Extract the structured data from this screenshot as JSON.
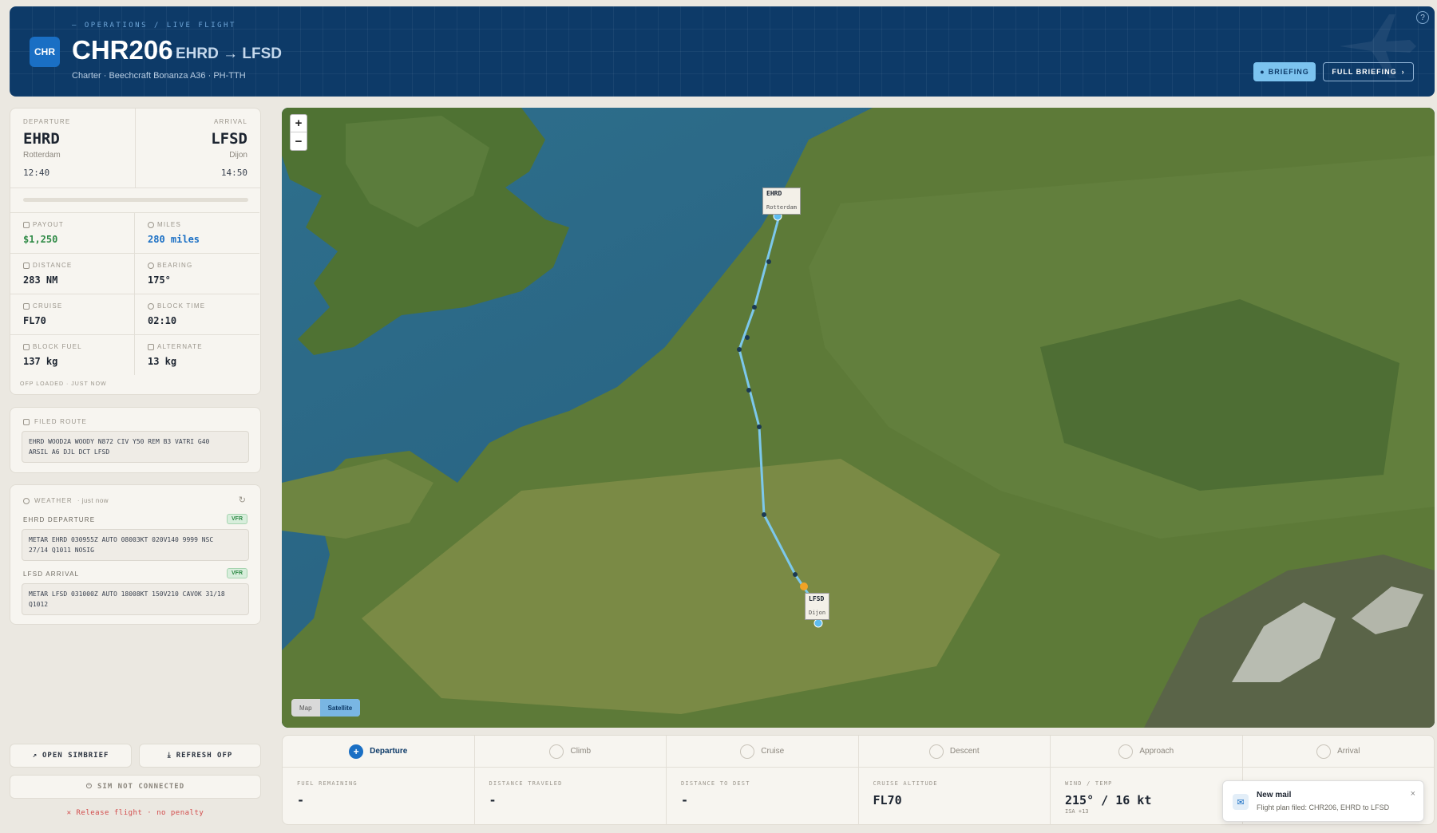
{
  "header": {
    "breadcrumb": "— OPERATIONS / LIVE FLIGHT",
    "logo": "CHR",
    "flight_number": "CHR206",
    "route": "EHRD → LFSD",
    "subtitle": "Charter · Beechcraft Bonanza A36 · PH-TTH",
    "briefing_label": "BRIEFING",
    "full_briefing_label": "FULL BRIEFING",
    "help_icon": "?"
  },
  "departure": {
    "label": "DEPARTURE",
    "icao": "EHRD",
    "city": "Rotterdam",
    "time": "12:40"
  },
  "arrival": {
    "label": "ARRIVAL",
    "icao": "LFSD",
    "city": "Dijon",
    "time": "14:50"
  },
  "progress_percent": 0,
  "stats": {
    "payout": {
      "label": "PAYOUT",
      "value": "$1,250"
    },
    "miles": {
      "label": "MILES",
      "value": "280 miles"
    },
    "distance": {
      "label": "DISTANCE",
      "value": "283 NM"
    },
    "bearing": {
      "label": "BEARING",
      "value": "175°"
    },
    "cruise": {
      "label": "CRUISE",
      "value": "FL70"
    },
    "block_time": {
      "label": "BLOCK TIME",
      "value": "02:10"
    },
    "block_fuel": {
      "label": "BLOCK FUEL",
      "value": "137 kg"
    },
    "alternate": {
      "label": "ALTERNATE",
      "value": "13 kg"
    }
  },
  "ofp_status": "OFP LOADED · JUST NOW",
  "filed_route": {
    "label": "FILED ROUTE",
    "line1": "EHRD WOOD2A WOODY N872 CIV Y50 REM B3 VATRI G40",
    "line2": "ARSIL A6 DJL DCT LFSD"
  },
  "weather": {
    "label": "WEATHER",
    "updated": "· just now",
    "departure_label": "EHRD DEPARTURE",
    "departure_cat": "VFR",
    "departure_metar_1": "METAR EHRD 030955Z AUTO 08003KT 020V140 9999 NSC",
    "departure_metar_2": "27/14 Q1011 NOSIG",
    "arrival_label": "LFSD ARRIVAL",
    "arrival_cat": "VFR",
    "arrival_metar_1": "METAR LFSD 031000Z AUTO 18008KT 150V210 CAVOK 31/18",
    "arrival_metar_2": "Q1012"
  },
  "actions": {
    "open_simbrief": "OPEN SIMBRIEF",
    "refresh_ofp": "REFRESH OFP",
    "sim_status": "SIM NOT CONNECTED",
    "release": "✕  Release flight · no penalty"
  },
  "map": {
    "zoom_in": "+",
    "zoom_out": "−",
    "toggle_map": "Map",
    "toggle_satellite": "Satellite",
    "dep_label": "EHRD",
    "dep_city": "Rotterdam",
    "arr_label": "LFSD",
    "arr_city": "Dijon",
    "route_color": "#7cc8ec"
  },
  "phases": [
    {
      "label": "Departure",
      "active": true
    },
    {
      "label": "Climb"
    },
    {
      "label": "Cruise"
    },
    {
      "label": "Descent"
    },
    {
      "label": "Approach"
    },
    {
      "label": "Arrival"
    }
  ],
  "live": {
    "fuel_remaining": {
      "label": "FUEL REMAINING",
      "value": "-"
    },
    "distance_traveled": {
      "label": "DISTANCE TRAVELED",
      "value": "-"
    },
    "distance_to_dest": {
      "label": "DISTANCE TO DEST",
      "value": "-"
    },
    "cruise_altitude": {
      "label": "CRUISE ALTITUDE",
      "value": "FL70"
    },
    "wind_temp": {
      "label": "WIND / TEMP",
      "value": "215° / 16 kt",
      "isa": "ISA +13"
    }
  },
  "toast": {
    "title": "New mail",
    "body": "Flight plan filed: CHR206, EHRD to LFSD",
    "close": "×"
  }
}
